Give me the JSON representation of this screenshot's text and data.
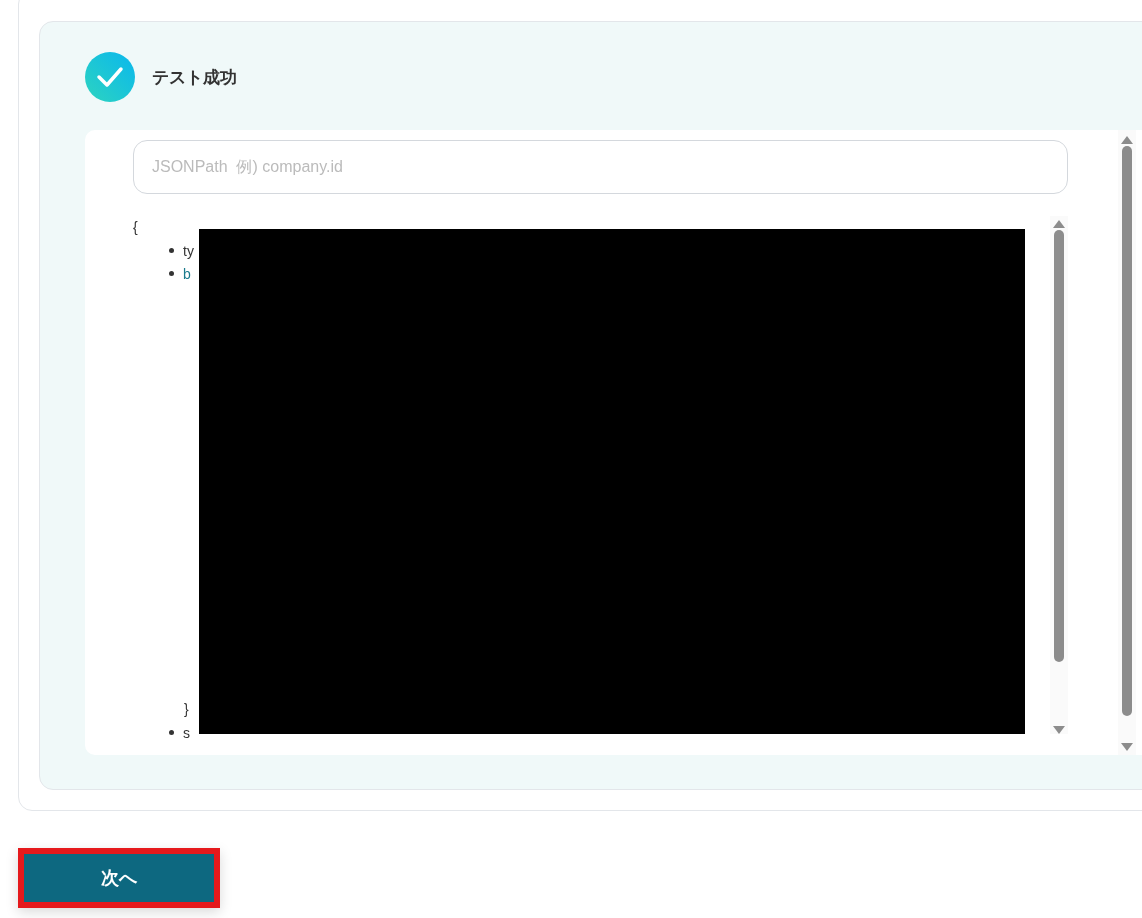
{
  "status": {
    "title": "テスト成功"
  },
  "search": {
    "placeholder": "JSONPath  例) company.id"
  },
  "json_preview": {
    "open_brace": "{",
    "items": [
      {
        "text": "ty",
        "kind": "key"
      },
      {
        "text": "b",
        "kind": "link"
      }
    ],
    "close_brace": "}",
    "trailing_items": [
      {
        "text": "s",
        "kind": "key"
      }
    ]
  },
  "buttons": [
    {
      "label": "次へ",
      "highlighted": true
    }
  ]
}
